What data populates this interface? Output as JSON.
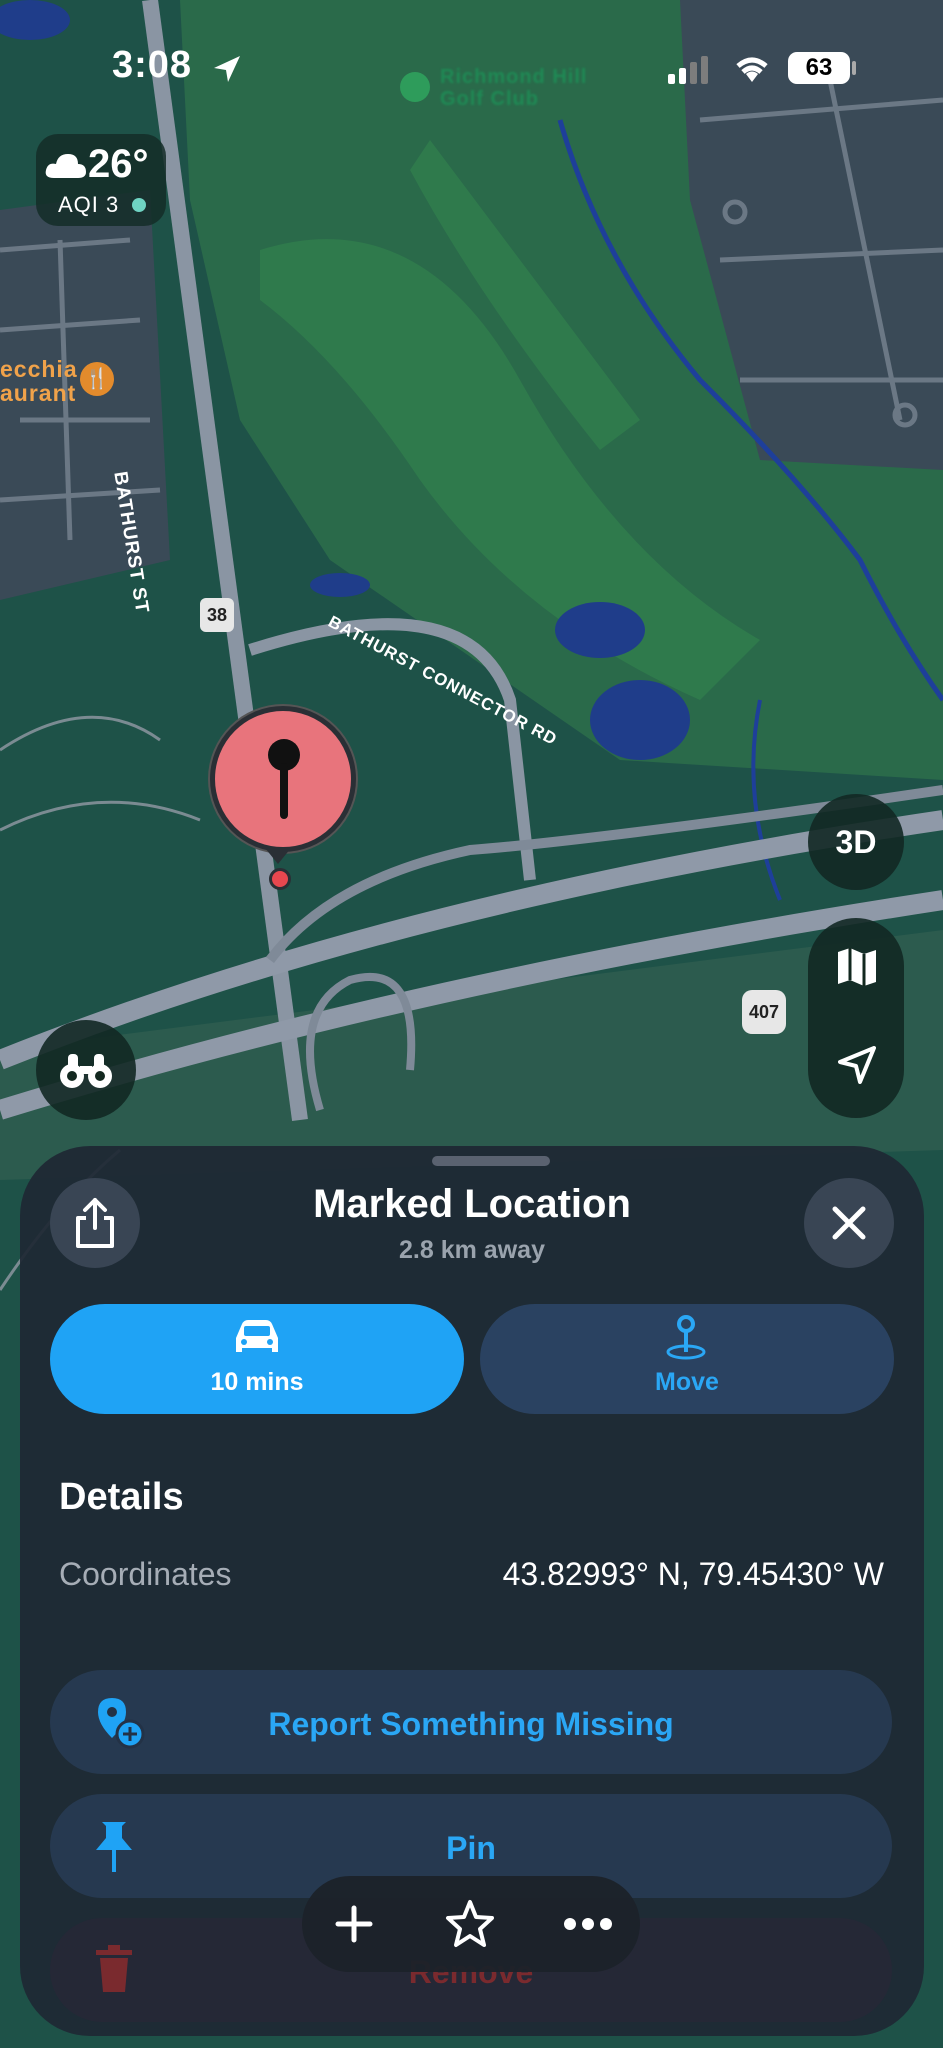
{
  "status_bar": {
    "time": "3:08",
    "battery": "63"
  },
  "weather": {
    "temperature": "26°",
    "aqi": "AQI 3"
  },
  "map": {
    "poi_golf": "Richmond Hill Golf Club",
    "poi_restaurant_line1": "ecchia",
    "poi_restaurant_line2": "aurant",
    "street_bathurst": "BATHURST ST",
    "street_connector": "BATHURST CONNECTOR RD",
    "route_38": "38",
    "route_407": "407"
  },
  "controls": {
    "three_d": "3D"
  },
  "sheet": {
    "title": "Marked Location",
    "subtitle": "2.8 km away",
    "drive_label": "10 mins",
    "move_label": "Move",
    "details_heading": "Details",
    "coordinates_label": "Coordinates",
    "coordinates_value": "43.82993° N, 79.45430° W",
    "report_label": "Report Something Missing",
    "pin_label": "Pin",
    "remove_label": "Remove"
  },
  "colors": {
    "accent": "#1fa3f5",
    "pin": "#e8747c",
    "water": "#1f3d8a",
    "sheet": "#1e2834"
  }
}
